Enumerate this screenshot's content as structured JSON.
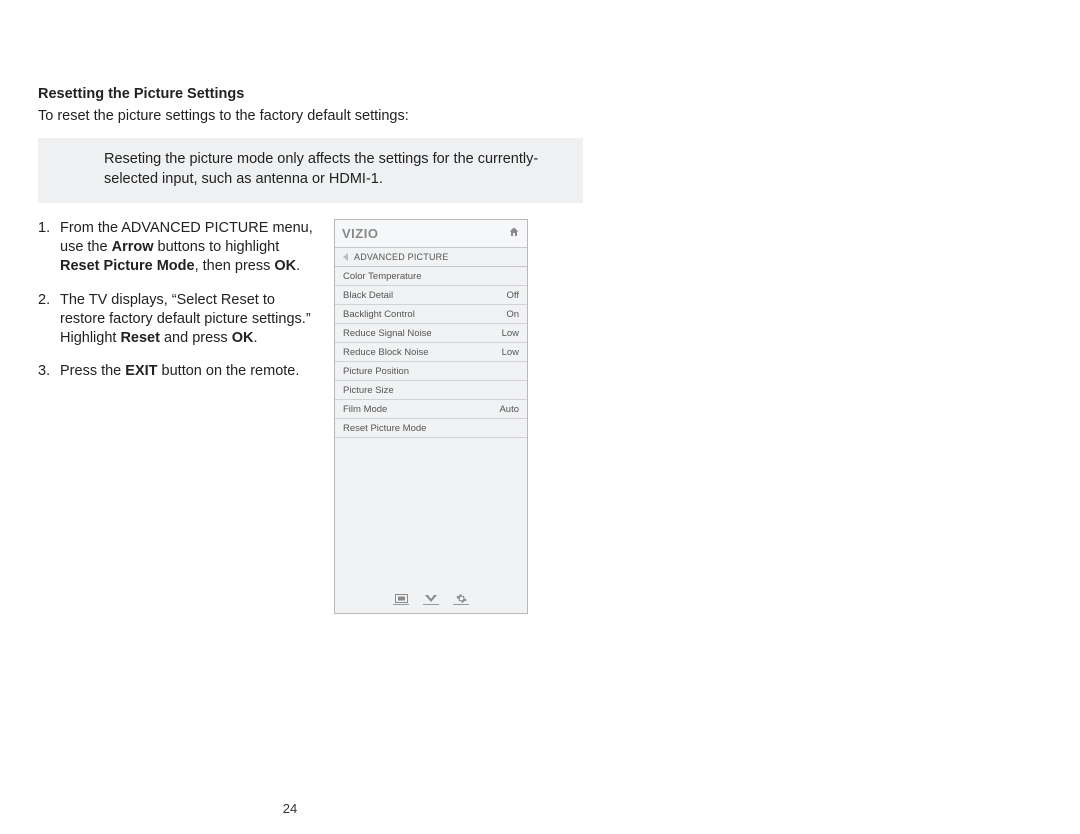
{
  "title": "Resetting the Picture Settings",
  "intro": "To reset the picture settings to the factory default settings:",
  "note": "Reseting the picture mode only affects the settings for the currently-selected input, such as antenna or HDMI-1.",
  "steps": {
    "s1": {
      "num": "1.",
      "p1": "From the ADVANCED PICTURE menu, use the ",
      "b1": "Arrow",
      "p2": " buttons to highlight ",
      "b2": "Reset Picture Mode",
      "p3": ", then press ",
      "b3": "OK",
      "p4": "."
    },
    "s2": {
      "num": "2.",
      "p1": "The TV displays, “Select Reset to restore factory default picture settings.” Highlight ",
      "b1": "Reset",
      "p2": " and press ",
      "b2": "OK",
      "p3": "."
    },
    "s3": {
      "num": "3.",
      "p1": "Press the ",
      "b1": "EXIT",
      "p2": " button on the remote."
    }
  },
  "panel": {
    "brand": "VIZIO",
    "crumb": "ADVANCED PICTURE",
    "items": [
      {
        "label": "Color Temperature",
        "value": ""
      },
      {
        "label": "Black Detail",
        "value": "Off"
      },
      {
        "label": "Backlight Control",
        "value": "On"
      },
      {
        "label": "Reduce Signal Noise",
        "value": "Low"
      },
      {
        "label": "Reduce Block Noise",
        "value": "Low"
      },
      {
        "label": "Picture Position",
        "value": ""
      },
      {
        "label": "Picture Size",
        "value": ""
      },
      {
        "label": "Film Mode",
        "value": "Auto"
      },
      {
        "label": "Reset Picture Mode",
        "value": ""
      }
    ]
  },
  "page_number": "24"
}
